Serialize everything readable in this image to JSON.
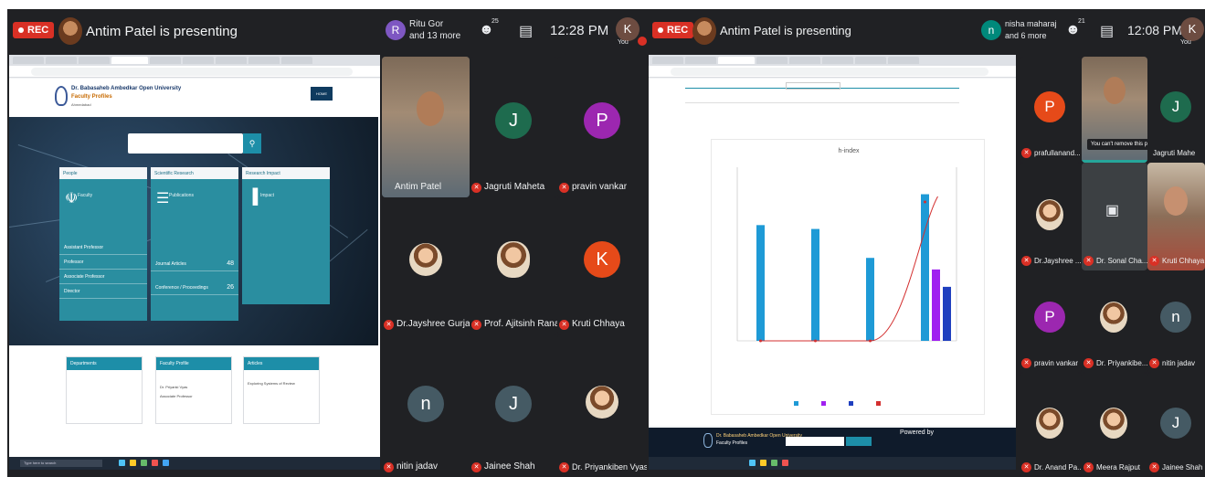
{
  "left": {
    "rec_label": "REC",
    "presenter_text": "Antim Patel is presenting",
    "others_avatar_letter": "R",
    "others_line1": "Ritu Gor",
    "others_line2": "and 13 more",
    "people_count": "25",
    "time": "12:28 PM",
    "you_letter": "K",
    "you_label": "You",
    "website": {
      "univ_name": "Dr. Babasaheb Ambedkar Open University",
      "univ_sub": "Faculty Profiles",
      "univ_sub2": "Ahmedabad",
      "home_label": "HOME",
      "cards": [
        {
          "head": "People",
          "title": "Faculty",
          "icon": "☫",
          "rows": [
            "Assistant Professor",
            "Professor",
            "Associate Professor",
            "Director"
          ]
        },
        {
          "head": "Scientific Research",
          "title": "Publications",
          "icon": "☰",
          "rows": [
            "Journal Articles",
            "Conference / Proceedings"
          ],
          "nums": [
            "48",
            "26"
          ]
        },
        {
          "head": "Research Impact",
          "title": "Impact",
          "icon": "▐",
          "rows": []
        }
      ],
      "lower_cards": [
        {
          "head": "Departments"
        },
        {
          "head": "Faculty Profile",
          "lines": [
            "Dr. Priyanki Vyas",
            "Associate Professor"
          ]
        },
        {
          "head": "Articles",
          "lines": [
            "Exploring Systems of Review"
          ]
        }
      ],
      "taskbar_search": "Type here to search"
    },
    "tiles": [
      {
        "name": "Antim Patel",
        "kind": "video"
      },
      {
        "name": "Jagruti Maheta",
        "letter": "J",
        "color": "#1e6b4e"
      },
      {
        "name": "pravin vankar",
        "letter": "P",
        "color": "#9c27b0"
      },
      {
        "name": "Dr.Jayshree Gurjar",
        "kind": "photo"
      },
      {
        "name": "Prof. Ajitsinh Rana",
        "kind": "photo"
      },
      {
        "name": "Kruti Chhaya",
        "letter": "K",
        "color": "#e64a19"
      },
      {
        "name": "nitin jadav",
        "letter": "n",
        "color": "#455a64"
      },
      {
        "name": "Jainee Shah",
        "letter": "J",
        "color": "#455a64"
      },
      {
        "name": "Dr. Priyankiben Vyas",
        "kind": "photo"
      }
    ]
  },
  "right": {
    "rec_label": "REC",
    "presenter_text": "Antim Patel is presenting",
    "others_avatar_letter": "n",
    "others_line1": "nisha maharaj",
    "others_line2": "and 6 more",
    "people_count": "21",
    "time": "12:08 PM",
    "you_letter": "K",
    "you_label": "You",
    "tooltip": "You can't remove this participant",
    "powered_label": "Powered by",
    "footer_name": "Dr. Babasaheb Ambedkar Open University",
    "footer_sub": "Faculty Profiles",
    "tiles": [
      {
        "name": "prafullanand...",
        "letter": "P",
        "color": "#e64a19"
      },
      {
        "name": "",
        "kind": "video"
      },
      {
        "name": "Jagruti Mahe",
        "letter": "J",
        "color": "#1e6b4e"
      },
      {
        "name": "Dr.Jayshree ...",
        "kind": "photo"
      },
      {
        "name": "Dr. Sonal Cha...",
        "kind": "off"
      },
      {
        "name": "Kruti Chhaya",
        "kind": "video2"
      },
      {
        "name": "pravin vankar",
        "letter": "P",
        "color": "#9c27b0"
      },
      {
        "name": "Dr. Priyankibe...",
        "kind": "photo"
      },
      {
        "name": "nitin jadav",
        "letter": "n",
        "color": "#455a64"
      },
      {
        "name": "Dr. Anand Pa...",
        "kind": "photo"
      },
      {
        "name": "Meera Rajput",
        "kind": "photo"
      },
      {
        "name": "Jainee Shah",
        "letter": "J",
        "color": "#455a64"
      }
    ]
  },
  "chart_data": {
    "type": "bar",
    "title": "h-index",
    "categories": [
      "",
      "",
      "",
      ""
    ],
    "series": [
      {
        "color": "#1e9ad6",
        "values": [
          6.0,
          5.8,
          4.3,
          7.6
        ]
      },
      {
        "color": "#a020f0",
        "values": [
          null,
          null,
          null,
          3.7
        ]
      },
      {
        "color": "#1f3fbf",
        "values": [
          null,
          null,
          null,
          2.8
        ]
      }
    ],
    "line_series": {
      "color": "#d32f2f",
      "values": [
        0,
        0,
        0,
        7.2
      ]
    },
    "ylim": [
      0,
      9
    ],
    "legend_position": "bottom"
  }
}
